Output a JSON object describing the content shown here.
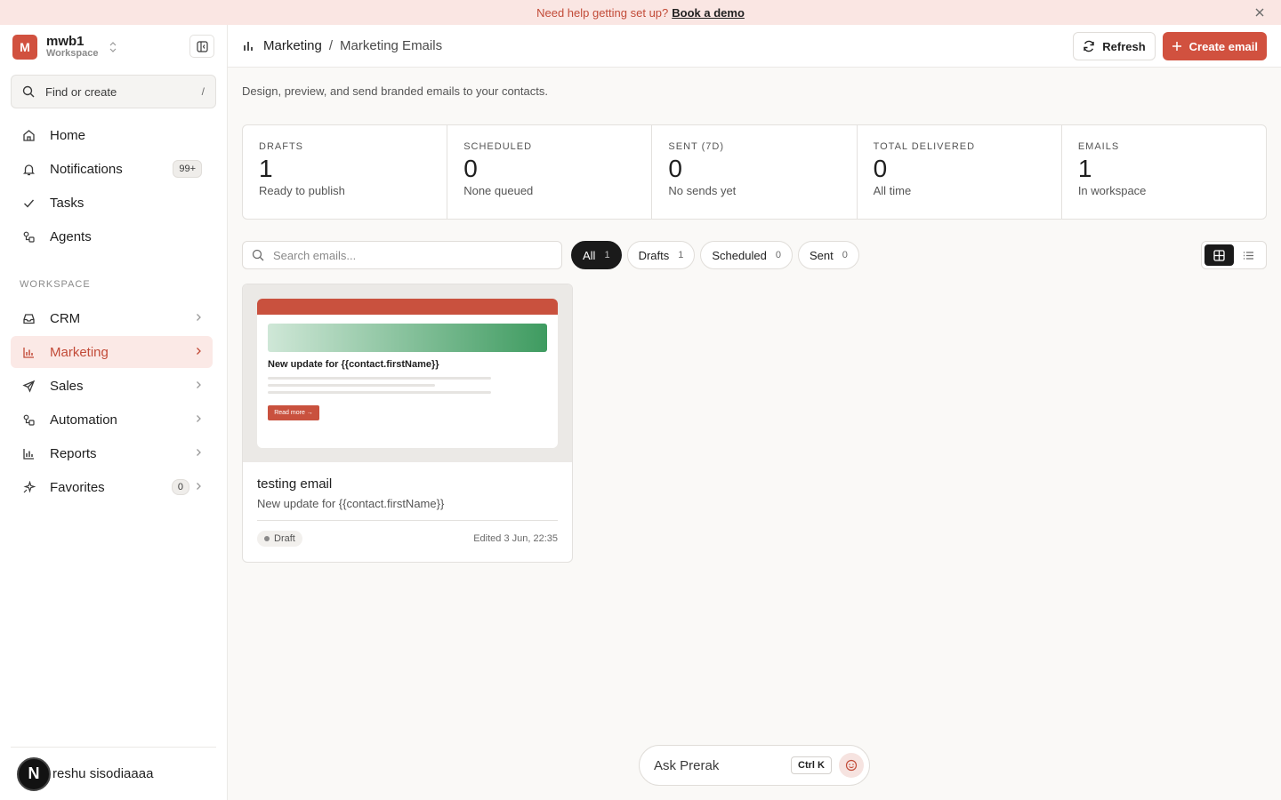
{
  "banner": {
    "text": "Need help getting set up?",
    "link": "Book a demo"
  },
  "workspace": {
    "initial": "M",
    "name": "mwb1",
    "type": "Workspace"
  },
  "find": {
    "label": "Find or create",
    "shortcut": "/"
  },
  "nav": {
    "home": "Home",
    "notifications": "Notifications",
    "notifications_count": "99+",
    "tasks": "Tasks",
    "agents": "Agents"
  },
  "workspace_section": {
    "label": "WORKSPACE",
    "crm": "CRM",
    "marketing": "Marketing",
    "sales": "Sales",
    "automation": "Automation",
    "reports": "Reports",
    "favorites": "Favorites",
    "favorites_count": "0"
  },
  "user": {
    "initial": "N",
    "name": "reshu sisodiaaaa"
  },
  "breadcrumb": {
    "section": "Marketing",
    "separator": "/",
    "page": "Marketing Emails"
  },
  "actions": {
    "refresh": "Refresh",
    "create": "Create email"
  },
  "description": "Design, preview, and send branded emails to your contacts.",
  "stats": [
    {
      "label": "DRAFTS",
      "value": "1",
      "sub": "Ready to publish"
    },
    {
      "label": "SCHEDULED",
      "value": "0",
      "sub": "None queued"
    },
    {
      "label": "SENT (7D)",
      "value": "0",
      "sub": "No sends yet"
    },
    {
      "label": "TOTAL DELIVERED",
      "value": "0",
      "sub": "All time"
    },
    {
      "label": "EMAILS",
      "value": "1",
      "sub": "In workspace"
    }
  ],
  "search": {
    "placeholder": "Search emails..."
  },
  "filters": [
    {
      "label": "All",
      "count": "1"
    },
    {
      "label": "Drafts",
      "count": "1"
    },
    {
      "label": "Scheduled",
      "count": "0"
    },
    {
      "label": "Sent",
      "count": "0"
    }
  ],
  "email_card": {
    "preview_title": "New update for {{contact.firstName}}",
    "preview_cta": "Read more →",
    "title": "testing email",
    "subject": "New update for {{contact.firstName}}",
    "status": "Draft",
    "edited": "Edited 3 Jun, 22:35"
  },
  "ask": {
    "label": "Ask Prerak",
    "shortcut": "Ctrl K"
  },
  "colors": {
    "accent": "#d1513f",
    "active_bg": "#fbe9e6",
    "banner_bg": "#fae6e3",
    "dark": "#1a1a1a"
  }
}
